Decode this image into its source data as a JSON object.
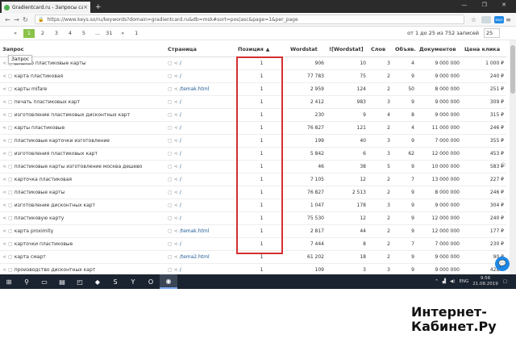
{
  "browser": {
    "tab_title": "Gradientcard.ru - Запросы са...",
    "tab_close": "×",
    "new_tab": "+",
    "url": "https://www.keys.so/ru/keywords?domain=gradientcard.ru&db=msk#sort=pos|asc&page=1&per_page",
    "ext_badge": "keys",
    "window_controls": "— ❐ ✕"
  },
  "pager": {
    "prev": "«",
    "pages": [
      "1",
      "2",
      "3",
      "4",
      "5"
    ],
    "ellipsis": "...",
    "last": "31",
    "next": "»",
    "current": "1",
    "count_text": "от 1 до 25 из 752 записей",
    "per_page": "25"
  },
  "tooltip": "Запрос",
  "table": {
    "headers": {
      "query": "Запрос",
      "page": "Страница",
      "position": "Позиция",
      "wordstat": "Wordstat",
      "wordstat_q": "![Wordstat]",
      "words": "Слов",
      "ads": "Объяв.",
      "docs": "Документов",
      "price": "Цена клика"
    },
    "rows": [
      {
        "query": "дешево пластиковые карты",
        "page": "/",
        "pos": "1",
        "ws": "906",
        "wsq": "10",
        "words": "3",
        "ads": "4",
        "docs": "9 000 000",
        "price": "1 000 ₽"
      },
      {
        "query": "карта пластиковая",
        "page": "/",
        "pos": "1",
        "ws": "77 783",
        "wsq": "75",
        "words": "2",
        "ads": "9",
        "docs": "9 000 000",
        "price": "240 ₽"
      },
      {
        "query": "карты mifare",
        "page": "/temak.html",
        "pos": "1",
        "ws": "2 959",
        "wsq": "124",
        "words": "2",
        "ads": "50",
        "docs": "8 000 000",
        "price": "251 ₽"
      },
      {
        "query": "печать пластиковых карт",
        "page": "/",
        "pos": "1",
        "ws": "2 412",
        "wsq": "983",
        "words": "3",
        "ads": "9",
        "docs": "9 000 000",
        "price": "309 ₽"
      },
      {
        "query": "изготовление пластиковых дисконтных карт",
        "page": "/",
        "pos": "1",
        "ws": "230",
        "wsq": "9",
        "words": "4",
        "ads": "8",
        "docs": "9 000 000",
        "price": "315 ₽"
      },
      {
        "query": "карты пластиковые",
        "page": "/",
        "pos": "1",
        "ws": "76 827",
        "wsq": "121",
        "words": "2",
        "ads": "4",
        "docs": "11 000 000",
        "price": "246 ₽"
      },
      {
        "query": "пластиковые карточки изготовление",
        "page": "/",
        "pos": "1",
        "ws": "199",
        "wsq": "40",
        "words": "3",
        "ads": "9",
        "docs": "7 000 000",
        "price": "355 ₽"
      },
      {
        "query": "изготовления пластиковых карт",
        "page": "/",
        "pos": "1",
        "ws": "5 842",
        "wsq": "6",
        "words": "3",
        "ads": "62",
        "docs": "12 000 000",
        "price": "453 ₽"
      },
      {
        "query": "пластиковые карты изготовление москва дешево",
        "page": "/",
        "pos": "1",
        "ws": "46",
        "wsq": "38",
        "words": "5",
        "ads": "9",
        "docs": "10 000 000",
        "price": "583 ₽"
      },
      {
        "query": "карточка пластиковая",
        "page": "/",
        "pos": "1",
        "ws": "7 105",
        "wsq": "12",
        "words": "2",
        "ads": "7",
        "docs": "13 000 000",
        "price": "227 ₽"
      },
      {
        "query": "пластиковые карты",
        "page": "/",
        "pos": "1",
        "ws": "76 827",
        "wsq": "2 513",
        "words": "2",
        "ads": "9",
        "docs": "8 000 000",
        "price": "246 ₽"
      },
      {
        "query": "изготовление дисконтных карт",
        "page": "/",
        "pos": "1",
        "ws": "1 047",
        "wsq": "178",
        "words": "3",
        "ads": "9",
        "docs": "9 000 000",
        "price": "304 ₽"
      },
      {
        "query": "пластиковую карту",
        "page": "/",
        "pos": "1",
        "ws": "75 530",
        "wsq": "12",
        "words": "2",
        "ads": "9",
        "docs": "12 000 000",
        "price": "240 ₽"
      },
      {
        "query": "карта proximity",
        "page": "/temak.html",
        "pos": "1",
        "ws": "2 817",
        "wsq": "44",
        "words": "2",
        "ads": "9",
        "docs": "12 000 000",
        "price": "177 ₽"
      },
      {
        "query": "карточки пластиковые",
        "page": "/",
        "pos": "1",
        "ws": "7 444",
        "wsq": "8",
        "words": "2",
        "ads": "7",
        "docs": "7 000 000",
        "price": "230 ₽"
      },
      {
        "query": "карта смарт",
        "page": "/tema2.html",
        "pos": "1",
        "ws": "61 202",
        "wsq": "18",
        "words": "2",
        "ads": "9",
        "docs": "9 000 000",
        "price": "90 ₽"
      },
      {
        "query": "производство дисконтных карт",
        "page": "/",
        "pos": "1",
        "ws": "109",
        "wsq": "3",
        "words": "3",
        "ads": "9",
        "docs": "9 000 000",
        "price": "428 ₽"
      }
    ]
  },
  "taskbar": {
    "lang": "ENG",
    "time": "9:56",
    "date": "21.08.2019"
  },
  "watermark": {
    "line1": "Интернет-",
    "line2": "Кабинет.Ру"
  },
  "colors": {
    "accent_green": "#8bc34a",
    "highlight_red": "#d32f2f",
    "link_blue": "#1e5a94",
    "taskbar": "#1a2330"
  }
}
